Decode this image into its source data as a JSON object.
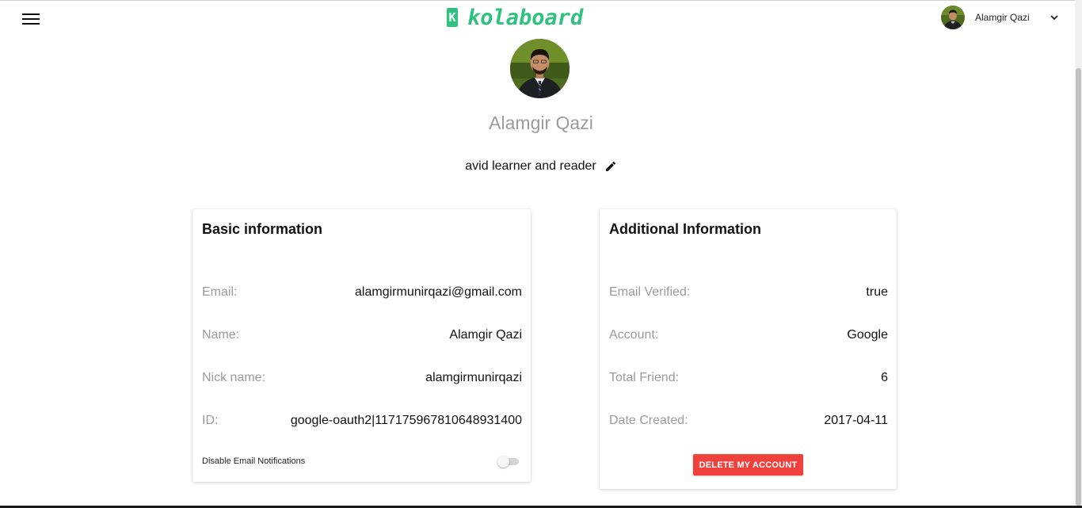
{
  "header": {
    "logo_mark": "K",
    "logo_text": "kolaboard",
    "user_name": "Alamgir Qazi",
    "brand_color": "#2ec27e"
  },
  "profile": {
    "name": "Alamgir Qazi",
    "bio": "avid learner and reader"
  },
  "basic_info": {
    "title": "Basic information",
    "rows": [
      {
        "label": "Email:",
        "value": "alamgirmunirqazi@gmail.com"
      },
      {
        "label": "Name:",
        "value": "Alamgir Qazi"
      },
      {
        "label": "Nick name:",
        "value": "alamgirmunirqazi"
      },
      {
        "label": "ID:",
        "value": "google-oauth2|117175967810648931400"
      }
    ],
    "notifications_label": "Disable Email Notifications",
    "notifications_enabled": false
  },
  "additional_info": {
    "title": "Additional Information",
    "rows": [
      {
        "label": "Email Verified:",
        "value": "true"
      },
      {
        "label": "Account:",
        "value": "Google"
      },
      {
        "label": "Total Friend:",
        "value": "6"
      },
      {
        "label": "Date Created:",
        "value": "2017-04-11"
      }
    ],
    "delete_label": "DELETE MY ACCOUNT",
    "delete_color": "#f0413d"
  },
  "icons": [
    "menu-icon",
    "chevron-down-icon",
    "pencil-icon"
  ]
}
